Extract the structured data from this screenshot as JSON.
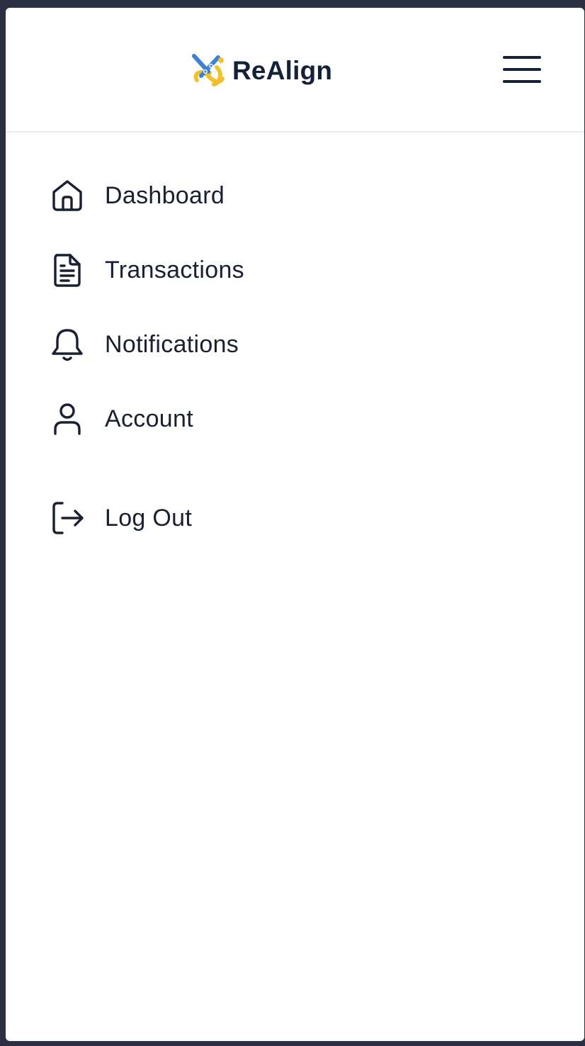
{
  "app": {
    "name": "ReAlign"
  },
  "header": {
    "logo_icon": "realign-logo-icon",
    "menu_icon": "hamburger-menu-icon"
  },
  "nav": {
    "items": [
      {
        "label": "Dashboard",
        "icon": "home-icon"
      },
      {
        "label": "Transactions",
        "icon": "document-icon"
      },
      {
        "label": "Notifications",
        "icon": "bell-icon"
      },
      {
        "label": "Account",
        "icon": "user-icon"
      }
    ],
    "logout": {
      "label": "Log Out",
      "icon": "logout-icon"
    }
  },
  "colors": {
    "background": "#ffffff",
    "text": "#1a2033",
    "brand_dark": "#14213a",
    "logo_blue": "#3b82d6",
    "logo_yellow": "#f2c12e",
    "divider": "#e7e9ee",
    "outer_frame": "#2b3142"
  }
}
